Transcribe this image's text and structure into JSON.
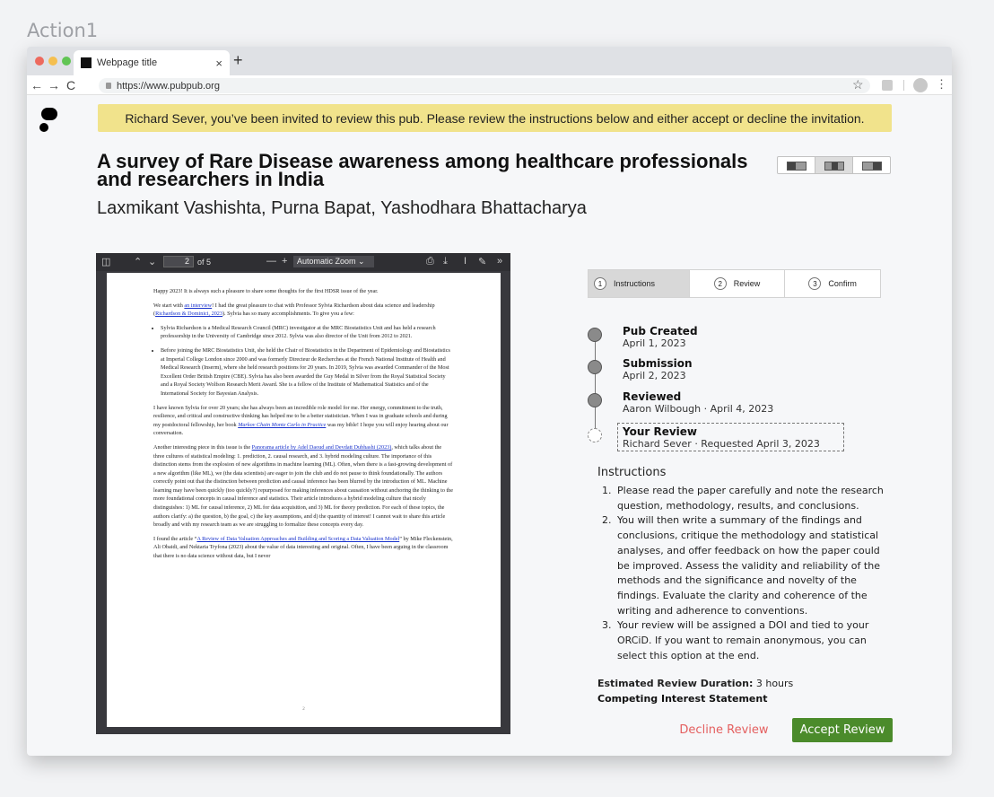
{
  "frame_label": "Action1",
  "browser": {
    "tab_title": "Webpage title",
    "tab_close": "×",
    "new_tab": "+",
    "back": "←",
    "forward": "→",
    "reload": "C",
    "url": "https://www.pubpub.org",
    "star": "☆",
    "menu": "⋮"
  },
  "banner": {
    "text": "Richard Sever, you’ve been invited to review this pub. Please review the instructions below and either accept or decline the invitation."
  },
  "pub": {
    "title": "A survey of Rare Disease awareness among healthcare professionals and researchers in India",
    "authors": "Laxmikant Vashishta, Purna Bapat, Yashodhara Bhattacharya"
  },
  "pdf": {
    "toolbar": {
      "sidebar": "◫",
      "up": "⌃",
      "down": "⌄",
      "page": "2",
      "of": "of 5",
      "zoom_out": "—",
      "zoom_in": "+",
      "zoom": "Automatic Zoom  ⌄",
      "print": "⎙",
      "save": "⤓",
      "text": "I",
      "draw": "✎",
      "more": "»"
    },
    "p1": "Happy 2023! It is always such a pleasure to share some thoughts for the first HDSR issue of the year.",
    "p2a": "We start with ",
    "p2link1": "an interview",
    "p2b": "! I had the great pleasure to chat with Professor Sylvia Richardson about data science and leadership (",
    "p2link2": "Richardson & Dominici, 2023",
    "p2c": "). Sylvia has so many accomplishments. To give you a few:",
    "b1": "Sylvia Richardson is a Medical Research Council (MRC) investigator at the MRC Biostatistics Unit and has held a research professorship in the University of Cambridge since 2012. Sylvia was also director of the Unit from 2012 to 2021.",
    "b2": "Before joining the MRC Biostatistics Unit, she held the Chair of Biostatistics in the Department of Epidemiology and Biostatistics at Imperial College London since 2000 and was formerly Directeur de Recherches at the French National Institute of Health and Medical Research (Inserm), where she held research positions for 20 years. In 2019, Sylvia was awarded Commander of the Most Excellent Order British Empire (CBE). Sylvia has also been awarded the Guy Medal in Silver from the Royal Statistical Society and a Royal Society Wolfson Research Merit Award. She is a fellow of the Institute of Mathematical Statistics and of the International Society for Bayesian Analysis.",
    "p3a": "I have known Sylvia for over 20 years; she has always been an incredible role model for me. Her energy, commitment to the truth, resilience, and critical and constructive thinking has helped me to be a better statistician. When I was in graduate schools and during my postdoctoral fellowship, her book ",
    "p3link": "Markov Chain Monte Carlo in Practice",
    "p3b": " was my bible! I hope you will enjoy hearing about our conversation.",
    "p4a": "Another interesting piece in this issue is the ",
    "p4link": "Panorama article by Adel Daoud and Devdatt Dubhashi (2023)",
    "p4b": ", which talks about the three cultures of statistical modeling: 1. prediction, 2. causal research, and 3. hybrid modeling culture. The importance of this distinction stems from the explosion of new algorithms in machine learning (ML). Often, when there is a fast-growing development of a new algorithm (like ML), we (the data scientists) are eager to join the club and do not pause to think foundationally. The authors correctly point out that the distinction between prediction and causal inference has been blurred by the introduction of ML. Machine learning may have been quickly (too quickly?) repurposed for making inferences about causation without anchoring the thinking to the more foundational concepts in causal inference and statistics. Their article introduces a hybrid modeling culture that nicely distinguishes: 1) ML for causal inference, 2) ML for data acquisition, and 3) ML for theory prediction. For each of these topics, the authors clarify: a) the question, b) the goal, c) the key assumptions, and d) the quantity of interest! I cannot wait to share this article broadly and with my research team as we are struggling to formalize these concepts every day.",
    "p5a": "I found the article “",
    "p5link": "A Review of Data Valuation Approaches and Building and Scoring a Data Valuation Model",
    "p5b": "” by Mike Fleckenstein, Ali Obaidi, and Nektaria Tryfona (2023) about the value of data interesting and original. Often, I have been arguing in the classroom that there is no data science without data, but I never",
    "footer_page": "2"
  },
  "stepper": {
    "steps": [
      {
        "num": "1",
        "label": "Instructions"
      },
      {
        "num": "2",
        "label": "Review"
      },
      {
        "num": "3",
        "label": "Confirm"
      }
    ]
  },
  "timeline": {
    "items": [
      {
        "title": "Pub Created",
        "sub": "April 1, 2023"
      },
      {
        "title": "Submission",
        "sub": "April 2, 2023"
      },
      {
        "title": "Reviewed",
        "sub": "Aaron Wilbough  ·  April 4, 2023"
      },
      {
        "title": "Your Review",
        "sub": "Richard Sever  ·  Requested April 3, 2023"
      }
    ]
  },
  "instructions": {
    "title": "Instructions",
    "items": [
      "Please read the paper carefully and note the research question, methodology, results, and conclusions.",
      "You will then write a summary of the findings and conclusions, critique the methodology and statistical analyses, and offer feedback on how the paper could be improved. Assess the validity and reliability of the methods and the significance and novelty of the findings. Evaluate the clarity and coherence of the writing and adherence to conventions.",
      "Your review will be assigned a DOI and tied to your ORCiD. If you want to remain anonymous, you can select this option at the end."
    ]
  },
  "meta": {
    "duration_label": "Estimated Review Duration:",
    "duration_value": "3 hours",
    "competing": "Competing Interest Statement"
  },
  "actions": {
    "decline": "Decline Review",
    "accept": "Accept Review"
  },
  "colors": {
    "banner": "#f1e38c",
    "accept": "#4b8b2b",
    "decline": "#e45f5f"
  }
}
